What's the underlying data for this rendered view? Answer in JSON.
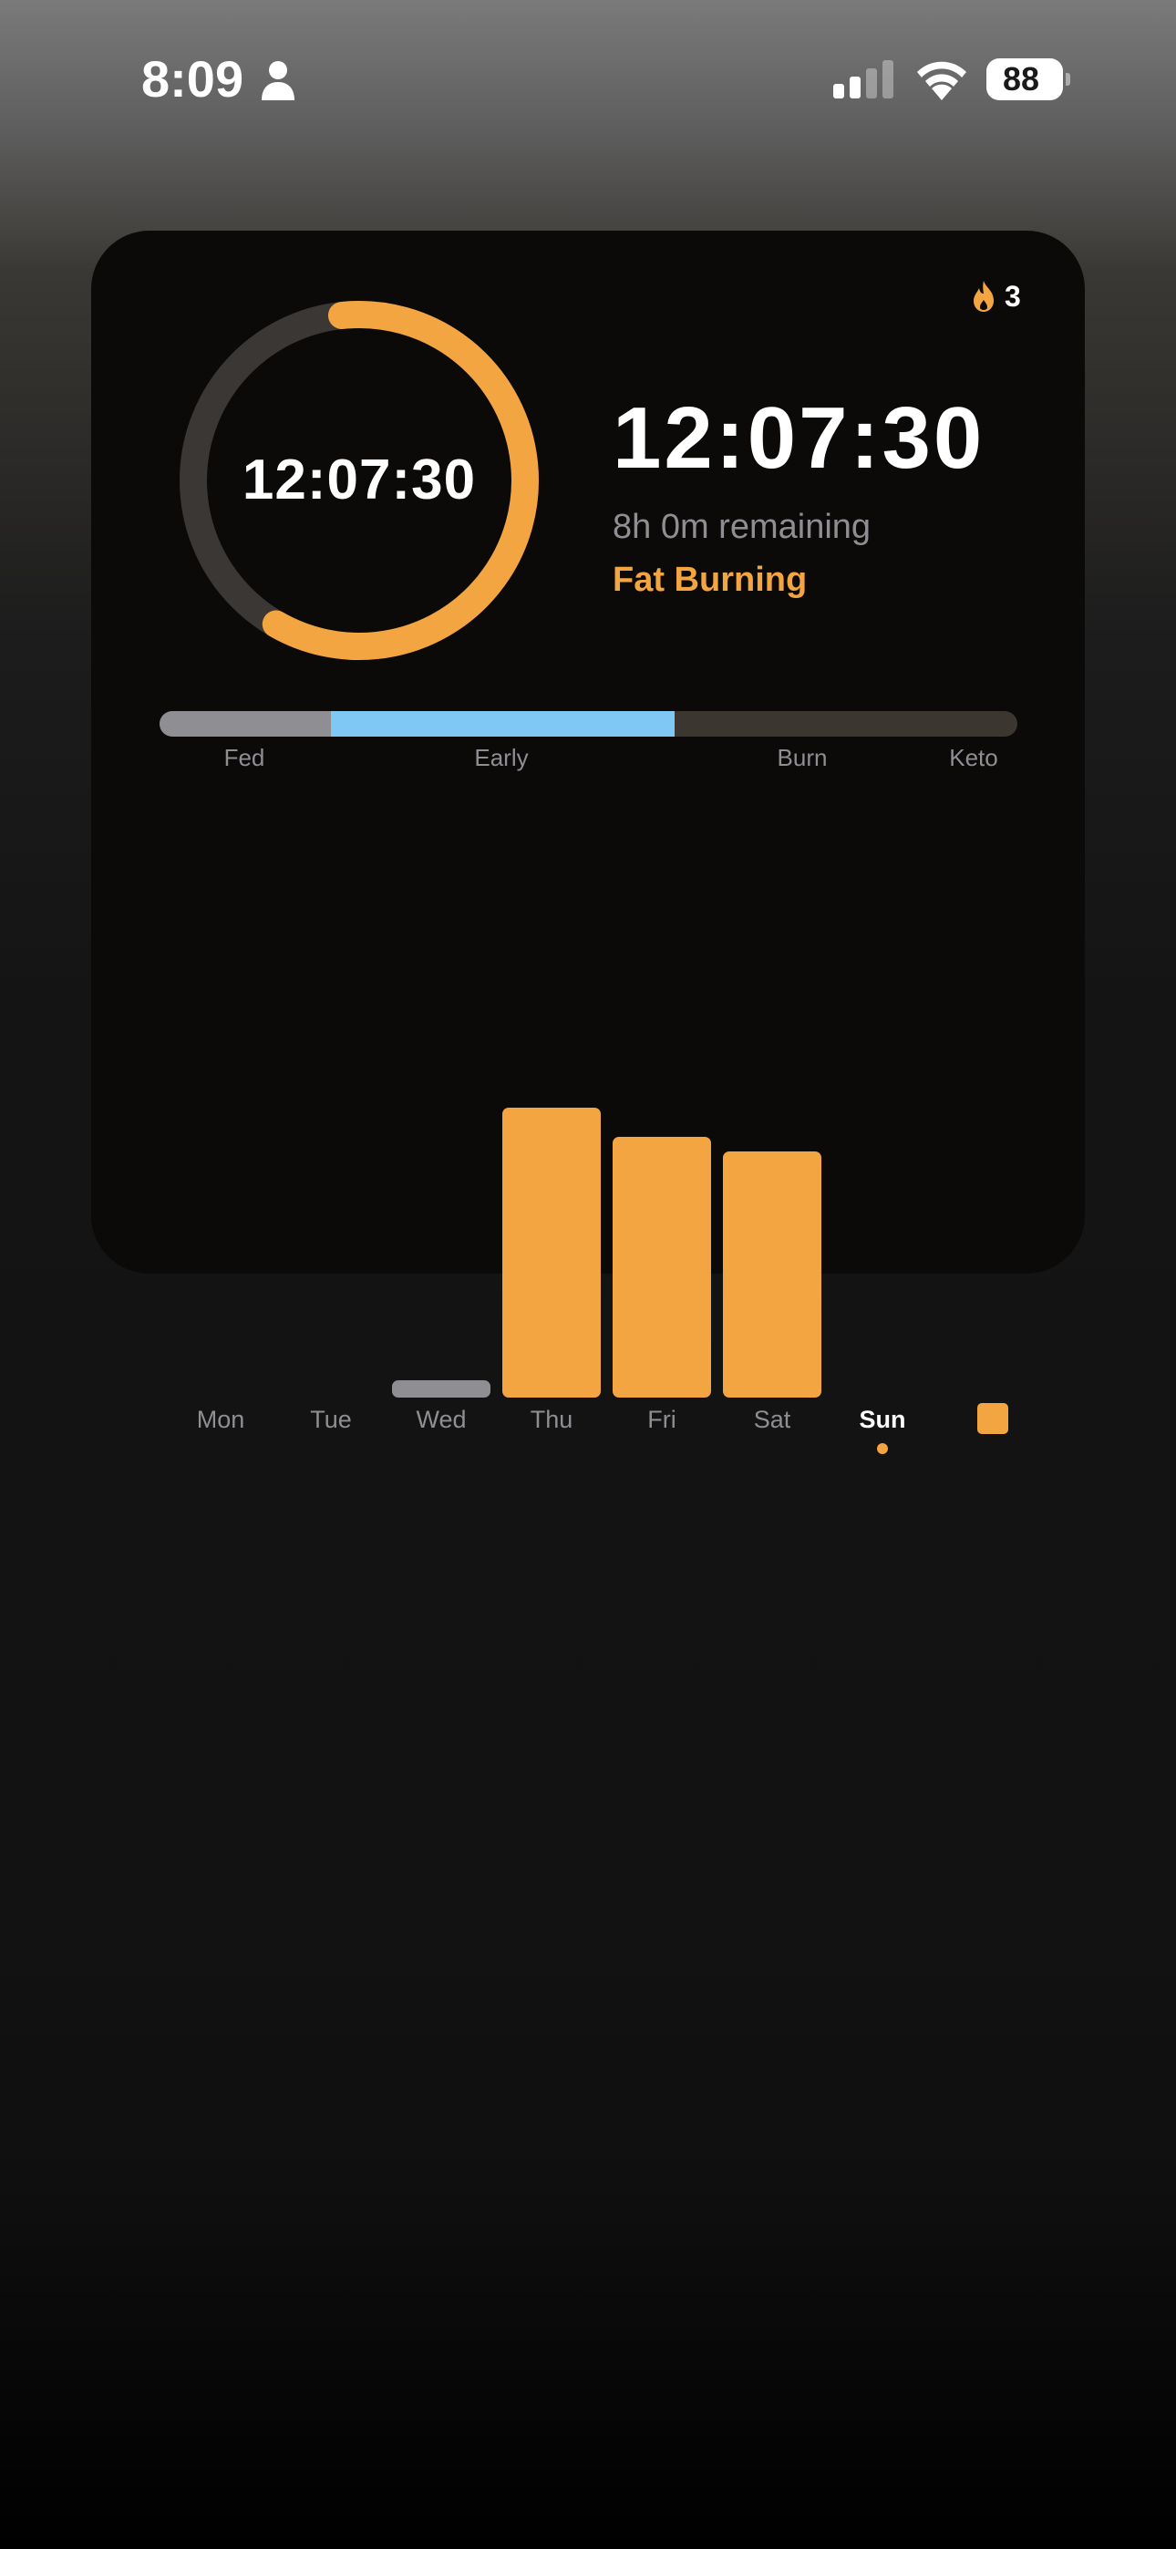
{
  "status_bar": {
    "time": "8:09",
    "battery_level": "88",
    "icons": [
      "person-icon",
      "cellular-signal-icon",
      "wifi-icon",
      "battery-icon"
    ]
  },
  "widget": {
    "streak": {
      "icon": "flame-icon",
      "count": "3"
    },
    "ring": {
      "time": "12:07:30",
      "progress": 0.6,
      "track_color": "#3a3734",
      "fill_color": "#f2a541"
    },
    "timer": {
      "elapsed": "12:07:30",
      "remaining": "8h 0m remaining",
      "stage": "Fat Burning"
    },
    "stages": {
      "labels": [
        "Fed",
        "Early",
        "Burn",
        "Keto"
      ],
      "colors": {
        "fed": "#8e8e93",
        "early": "#7fc8f5",
        "remaining": "#3b3630"
      }
    },
    "weekly_chart": {
      "days": [
        "Mon",
        "Tue",
        "Wed",
        "Thu",
        "Fri",
        "Sat",
        "Sun"
      ],
      "values": [
        0,
        0,
        0.06,
        1.0,
        0.9,
        0.85,
        0
      ],
      "bar_colors": [
        "#f2a541",
        "#f2a541",
        "#8e8e93",
        "#f2a541",
        "#f2a541",
        "#f2a541",
        "#f2a541"
      ],
      "today": "Sun",
      "accent_color": "#f2a541"
    }
  }
}
